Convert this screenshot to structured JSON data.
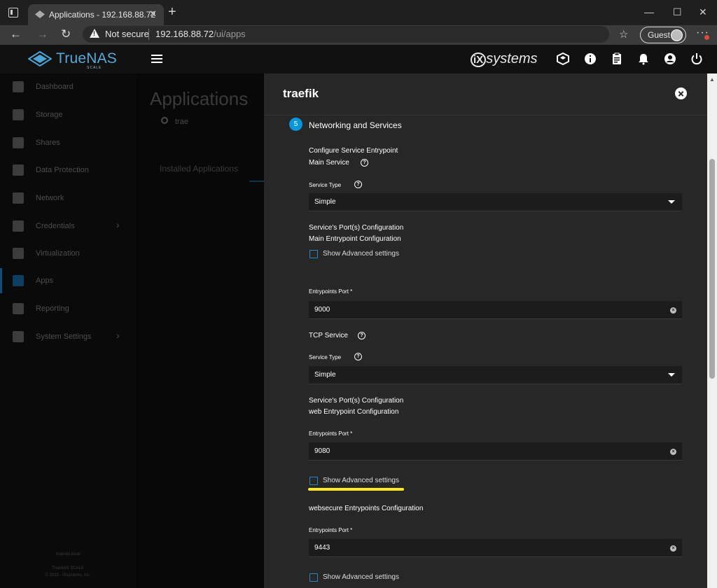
{
  "browser": {
    "tab_title": "Applications - 192.168.88.72",
    "tab_close": "✕",
    "new_tab": "+",
    "win_min": "—",
    "win_max": "☐",
    "win_close": "✕",
    "back": "←",
    "forward": "→",
    "reload": "↻",
    "not_secure": "Not secure",
    "url_host": "192.168.88.72",
    "url_path": "/ui/apps",
    "favorites": "☆",
    "guest_label": "Guest",
    "more": "···"
  },
  "header": {
    "logo_text": "TrueNAS",
    "logo_sub": "SCALE",
    "ix_mark": "iX",
    "ix_text": "systems"
  },
  "sidebar": {
    "items": [
      {
        "label": "Dashboard",
        "icon": "dashboard-icon"
      },
      {
        "label": "Storage",
        "icon": "storage-icon"
      },
      {
        "label": "Shares",
        "icon": "shares-icon"
      },
      {
        "label": "Data Protection",
        "icon": "shield-icon"
      },
      {
        "label": "Network",
        "icon": "network-icon"
      },
      {
        "label": "Credentials",
        "icon": "key-icon",
        "has_arrow": true
      },
      {
        "label": "Virtualization",
        "icon": "laptop-icon"
      },
      {
        "label": "Apps",
        "icon": "apps-icon",
        "active": true
      },
      {
        "label": "Reporting",
        "icon": "reporting-icon"
      },
      {
        "label": "System Settings",
        "icon": "gear-icon",
        "has_arrow": true
      }
    ],
    "arrow": "›",
    "footer_host": "truenas.local",
    "footer_product": "TrueNAS SCALE",
    "footer_copyright": "© 2023 - iXsystems, Inc."
  },
  "main": {
    "title": "Applications",
    "search_value": "trae",
    "installed_tab": "Installed Applications"
  },
  "panel": {
    "title": "traefik",
    "step_number": "5",
    "section_title": "Networking and Services",
    "configure_service_entrypoint": "Configure Service Entrypoint",
    "main_service": "Main Service",
    "service_type_label": "Service Type",
    "service_type_value": "Simple",
    "ports_config": "Service's Port(s) Configuration",
    "main_entrypoint_config": "Main Entrypoint Configuration",
    "show_advanced": "Show Advanced settings",
    "entrypoints_port_label": "Entrypoints Port *",
    "main_port": "9000",
    "tcp_service": "TCP Service",
    "tcp_service_type_value": "Simple",
    "web_entrypoint_config": "web Entrypoint Configuration",
    "web_port": "9080",
    "websecure_config": "websecure Entrypoints Configuration",
    "websecure_port": "9443",
    "help_glyph": "?",
    "clear_glyph": "×"
  }
}
